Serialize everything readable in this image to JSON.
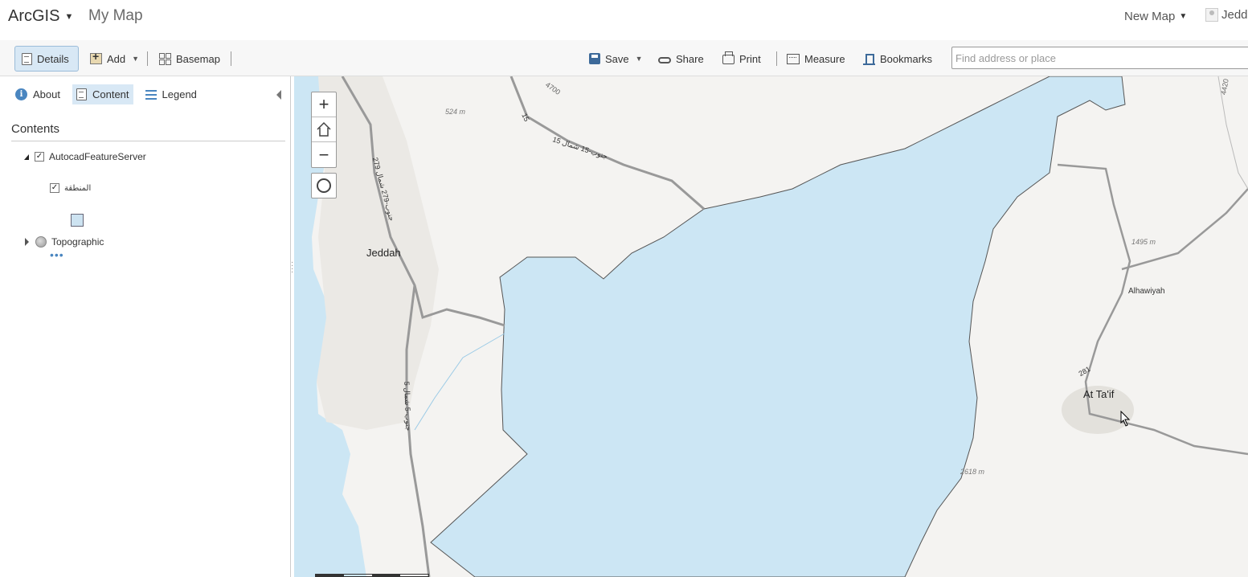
{
  "header": {
    "brand": "ArcGIS",
    "map_title": "My Map",
    "new_map": "New Map",
    "user": "Jedd"
  },
  "toolbar": {
    "details": "Details",
    "add": "Add",
    "basemap": "Basemap",
    "save": "Save",
    "share": "Share",
    "print": "Print",
    "measure": "Measure",
    "bookmarks": "Bookmarks",
    "search_placeholder": "Find address or place"
  },
  "panel": {
    "tabs": [
      {
        "label": "About",
        "icon": "info-icon"
      },
      {
        "label": "Content",
        "icon": "document-icon"
      },
      {
        "label": "Legend",
        "icon": "list-icon"
      }
    ],
    "active_tab": "Content",
    "contents_title": "Contents",
    "layers": [
      {
        "name": "AutocadFeatureServer",
        "expanded": true,
        "checked": true,
        "sublayers": [
          {
            "name": "المنطقة",
            "checked": true,
            "symbol_color": "#cde3f1"
          }
        ]
      },
      {
        "name": "Topographic",
        "expanded": false
      }
    ]
  },
  "map": {
    "labels": {
      "jeddah": "Jeddah",
      "taif": "At Ta'if",
      "alhawiyah": "Alhawiyah",
      "elev1": "524 m",
      "elev2": "1495 m",
      "elev3": "2618 m",
      "route15": "15 جنوب-15 شمال",
      "route279": "279 جنوب-279 شمال",
      "route5": "5 جنوب-5 شمال",
      "r4700": "4700",
      "r4420": "4420",
      "r15": "15",
      "r281": "281"
    },
    "water_color": "#cce6f4",
    "land_color": "#f4f3f1"
  }
}
